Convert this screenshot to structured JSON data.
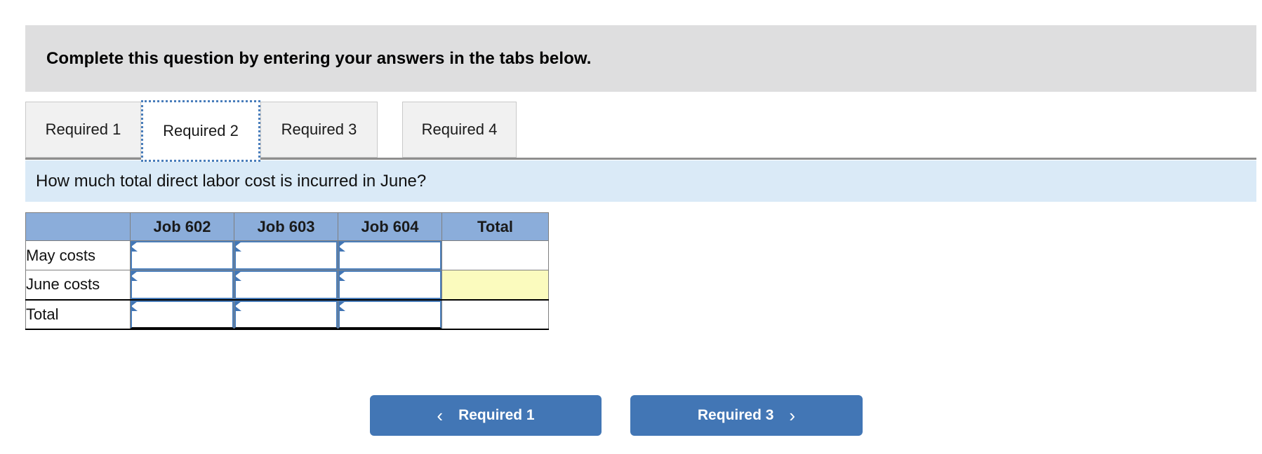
{
  "instruction": {
    "text": "Complete this question by entering your answers in the tabs below."
  },
  "tabs": {
    "items": [
      {
        "label": "Required 1",
        "active": false
      },
      {
        "label": "Required 2",
        "active": true
      },
      {
        "label": "Required 3",
        "active": false
      },
      {
        "label": "Required 4",
        "active": false
      }
    ]
  },
  "question": {
    "text": "How much total direct labor cost is incurred in June?"
  },
  "table": {
    "headers": [
      "",
      "Job 602",
      "Job 603",
      "Job 604",
      "Total"
    ],
    "rows": [
      {
        "label": "May costs",
        "cells": [
          {
            "type": "input",
            "value": ""
          },
          {
            "type": "input",
            "value": ""
          },
          {
            "type": "input",
            "value": ""
          },
          {
            "type": "plain",
            "value": ""
          }
        ]
      },
      {
        "label": "June costs",
        "cells": [
          {
            "type": "input",
            "value": ""
          },
          {
            "type": "input",
            "value": ""
          },
          {
            "type": "input",
            "value": ""
          },
          {
            "type": "highlight",
            "value": ""
          }
        ]
      },
      {
        "label": "Total",
        "cells": [
          {
            "type": "input",
            "value": ""
          },
          {
            "type": "input",
            "value": ""
          },
          {
            "type": "input",
            "value": ""
          },
          {
            "type": "plain",
            "value": ""
          }
        ]
      }
    ]
  },
  "navigation": {
    "prev_label": "Required 1",
    "next_label": "Required 3",
    "prev_icon": "chevron-left-icon",
    "next_icon": "chevron-right-icon",
    "prev_chevron": "‹",
    "next_chevron": "›"
  },
  "colors": {
    "banner_bg": "#dededf",
    "question_bg": "#daeaf7",
    "table_header_bg": "#8badda",
    "highlight_cell_bg": "#fbfbbe",
    "accent_blue": "#4276b5",
    "input_border": "#4a7ebb",
    "tab_inactive_bg": "#f1f1f1",
    "tab_active_bg": "#ffffff"
  }
}
